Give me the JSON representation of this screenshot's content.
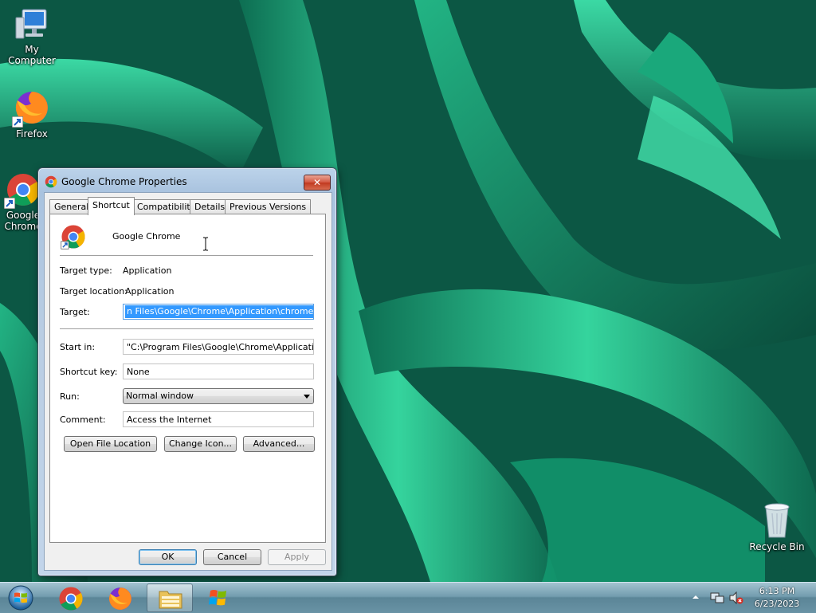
{
  "desktop": {
    "icons": [
      {
        "label": "My Computer"
      },
      {
        "label": "Firefox"
      },
      {
        "label": "Google Chrome"
      },
      {
        "label": "Recycle Bin"
      }
    ]
  },
  "dialog": {
    "title": "Google Chrome Properties",
    "close_label": "✕",
    "tabs": [
      "General",
      "Shortcut",
      "Compatibility",
      "Details",
      "Previous Versions"
    ],
    "active_tab": "Shortcut",
    "app_name": "Google Chrome",
    "target_type_label": "Target type:",
    "target_type_value": "Application",
    "target_location_label": "Target location:",
    "target_location_value": "Application",
    "target_label": "Target:",
    "target_value": "n Files\\Google\\Chrome\\Application\\chrome.exe\"",
    "start_in_label": "Start in:",
    "start_in_value": "\"C:\\Program Files\\Google\\Chrome\\Application\"",
    "shortcut_key_label": "Shortcut key:",
    "shortcut_key_value": "None",
    "run_label": "Run:",
    "run_value": "Normal window",
    "comment_label": "Comment:",
    "comment_value": "Access the Internet",
    "open_file_location_label": "Open File Location",
    "change_icon_label": "Change Icon...",
    "advanced_label": "Advanced...",
    "ok_label": "OK",
    "cancel_label": "Cancel",
    "apply_label": "Apply"
  },
  "taskbar": {
    "clock_time": "6:13 PM",
    "clock_date": "6/23/2023",
    "pinned": [
      "start-orb",
      "chrome-icon",
      "firefox-icon",
      "file-explorer-icon",
      "windows-flag-icon"
    ],
    "active_pinned": "file-explorer-icon"
  },
  "colors": {
    "selection": "#3399ff",
    "wallpaper_dark": "#0a4d3c",
    "wallpaper_light": "#2fd29a"
  }
}
